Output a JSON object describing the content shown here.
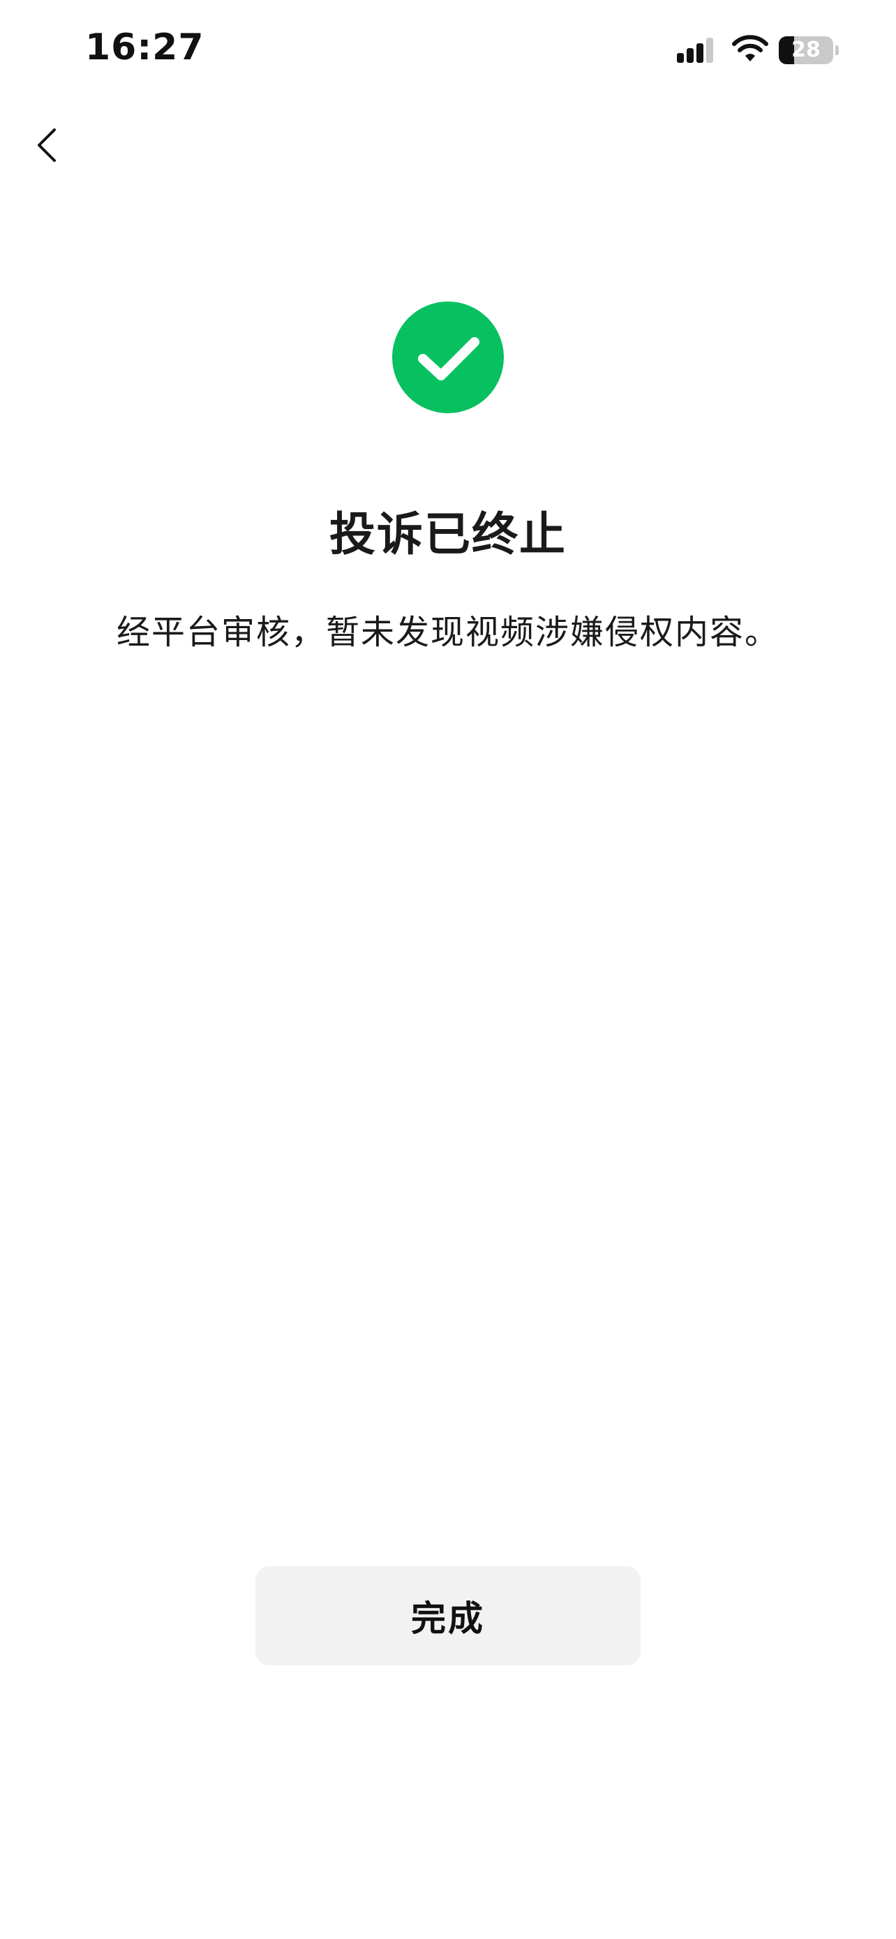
{
  "status_bar": {
    "time": "16:27",
    "battery_level": "28",
    "battery_fraction": 0.28
  },
  "nav": {
    "back_icon": "chevron-left-icon"
  },
  "result": {
    "icon": "check-circle-icon",
    "icon_color": "#07c160",
    "title": "投诉已终止",
    "description": "经平台审核，暂未发现视频涉嫌侵权内容。"
  },
  "footer": {
    "done_label": "完成"
  }
}
